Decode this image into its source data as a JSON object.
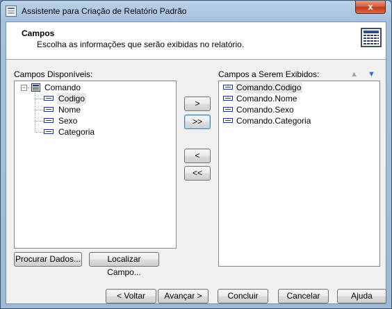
{
  "window": {
    "title": "Assistente para Criação de Relatório Padrão",
    "close_label": "x"
  },
  "header": {
    "title": "Campos",
    "subtitle": "Escolha as informações que serão exibidas no relatório."
  },
  "available": {
    "label": "Campos Disponíveis:",
    "root": "Comando",
    "root_expander": "−",
    "fields": [
      "Codigo",
      "Nome",
      "Sexo",
      "Categoria"
    ],
    "selected": "Codigo"
  },
  "displayed": {
    "label": "Campos a Serem Exibidos:",
    "fields": [
      "Comando.Codigo",
      "Comando.Nome",
      "Comando.Sexo",
      "Comando.Categoria"
    ],
    "selected": "Comando.Codigo"
  },
  "transfer_buttons": {
    "add": ">",
    "add_all": ">>",
    "remove": "<",
    "remove_all": "<<"
  },
  "lower_buttons": {
    "browse_data": "Procurar Dados...",
    "find_field": "Localizar Campo..."
  },
  "footer_buttons": {
    "back": "< Voltar",
    "next": "Avançar >",
    "finish": "Concluir",
    "cancel": "Cancelar",
    "help": "Ajuda"
  },
  "icons": {
    "move_up": "arrow-up-icon",
    "move_down": "arrow-down-icon"
  }
}
